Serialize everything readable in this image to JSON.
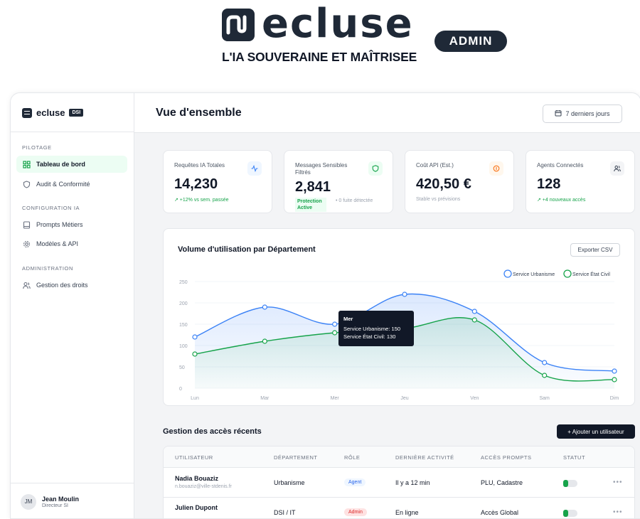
{
  "brand": {
    "name": "ecluse",
    "badge": "ADMIN",
    "tagline": "L'IA SOUVERAINE ET MAÎTRISEE"
  },
  "sidebar": {
    "logo_text": "ecluse",
    "logo_badge": "DSI",
    "sections": [
      {
        "label": "PILOTAGE"
      },
      {
        "label": "CONFIGURATION IA"
      },
      {
        "label": "ADMINISTRATION"
      }
    ],
    "items": [
      {
        "label": "Tableau de bord",
        "icon": "grid-icon",
        "active": true
      },
      {
        "label": "Audit & Conformité",
        "icon": "shield-icon",
        "active": false
      },
      {
        "label": "Prompts Métiers",
        "icon": "book-icon",
        "active": false
      },
      {
        "label": "Modèles & API",
        "icon": "gear-icon",
        "active": false
      },
      {
        "label": "Gestion des droits",
        "icon": "users-icon",
        "active": false
      }
    ],
    "user": {
      "initials": "JM",
      "name": "Jean Moulin",
      "role": "Directeur SI"
    }
  },
  "header": {
    "title": "Vue d'ensemble",
    "period": "7 derniers jours"
  },
  "kpis": [
    {
      "title": "Requêtes IA Totales",
      "value": "14,230",
      "sub": "↗ +12% vs sem. passée",
      "icon": "activity-icon",
      "color": "#3b82f6"
    },
    {
      "title": "Messages Sensibles Filtrés",
      "value": "2,841",
      "tag": "Protection Active",
      "tag2": "• 0 fuite détectée",
      "icon": "shield-icon",
      "color": "#16a34a"
    },
    {
      "title": "Coût API (Est.)",
      "value": "420,50 €",
      "sub": "Stable vs prévisions",
      "icon": "coin-icon",
      "color": "#f97316"
    },
    {
      "title": "Agents Connectés",
      "value": "128",
      "sub": "↗ +4 nouveaux accès",
      "icon": "users-icon",
      "color": "#374151"
    }
  ],
  "chart": {
    "title": "Volume d'utilisation par Département",
    "export_label": "Exporter CSV"
  },
  "chart_data": {
    "type": "area",
    "categories": [
      "Lun",
      "Mar",
      "Mer",
      "Jeu",
      "Ven",
      "Sam",
      "Dim"
    ],
    "series": [
      {
        "name": "Service Urbanisme",
        "values": [
          120,
          190,
          150,
          220,
          180,
          60,
          40
        ],
        "color": "#3b82f6"
      },
      {
        "name": "Service État Civil",
        "values": [
          80,
          110,
          130,
          140,
          160,
          30,
          20
        ],
        "color": "#16a34a"
      }
    ],
    "yticks": [
      0,
      50,
      100,
      150,
      200,
      250
    ],
    "ylim": [
      0,
      250
    ],
    "legend": "top-right",
    "grid": true,
    "tooltip": {
      "title": "Mer",
      "line1": "Service Urbanisme: 150",
      "line2": "Service État Civil: 130"
    }
  },
  "table": {
    "title": "Gestion des accès récents",
    "add_label": "+ Ajouter un utilisateur",
    "headers": [
      "UTILISATEUR",
      "DÉPARTEMENT",
      "RÔLE",
      "DERNIÈRE ACTIVITÉ",
      "ACCÈS PROMPTS",
      "STATUT"
    ],
    "rows": [
      {
        "name": "Nadia Bouaziz",
        "email": "n.bouaziz@ville-stdenis.fr",
        "dept": "Urbanisme",
        "role": "Agent",
        "activity": "Il y a 12 min",
        "prompts": "PLU, Cadastre",
        "more": "•••"
      },
      {
        "name": "Julien Dupont",
        "email": "",
        "dept": "DSI / IT",
        "role": "Admin",
        "activity": "En ligne",
        "prompts": "Accès Global",
        "more": "•••"
      }
    ]
  }
}
